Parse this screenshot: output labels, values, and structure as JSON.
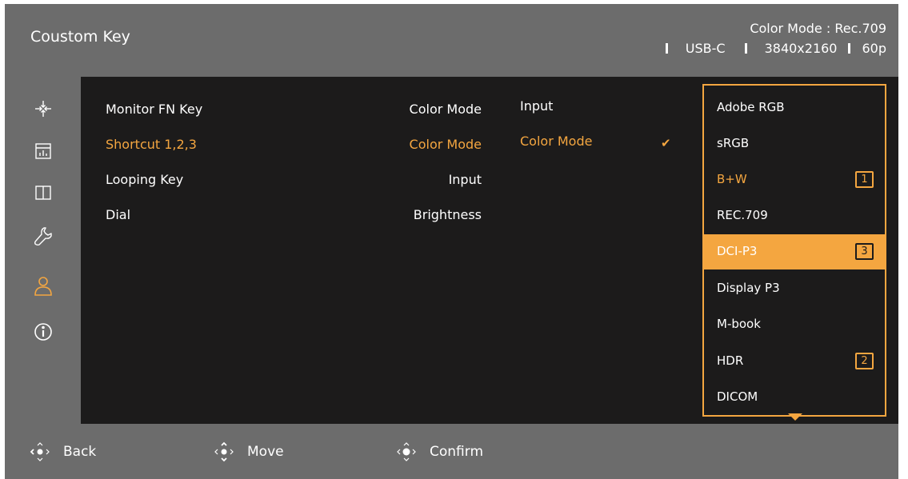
{
  "header": {
    "title": "Coustom Key",
    "color_mode": "Color Mode : Rec.709",
    "input": "USB-C",
    "resolution": "3840x2160",
    "refresh": "60p"
  },
  "sidebar": {
    "icons": [
      "picture-adjust-icon",
      "color-chart-icon",
      "layout-icon",
      "wrench-icon",
      "user-icon",
      "info-icon"
    ],
    "active_index": 4
  },
  "menu": {
    "column1": [
      {
        "label": "Monitor FN Key"
      },
      {
        "label": "Shortcut 1,2,3"
      },
      {
        "label": "Looping Key"
      },
      {
        "label": "Dial"
      }
    ],
    "column2": [
      {
        "label": "Color Mode"
      },
      {
        "label": "Color Mode"
      },
      {
        "label": "Input"
      },
      {
        "label": "Brightness"
      }
    ],
    "column3": [
      {
        "label": "Input"
      },
      {
        "label": "Color Mode"
      }
    ]
  },
  "dropdown": {
    "items": [
      {
        "label": "Adobe RGB",
        "badge": ""
      },
      {
        "label": "sRGB",
        "badge": ""
      },
      {
        "label": "B+W",
        "badge": "1"
      },
      {
        "label": "REC.709",
        "badge": ""
      },
      {
        "label": "DCI-P3",
        "badge": "3"
      },
      {
        "label": "Display P3",
        "badge": ""
      },
      {
        "label": "M-book",
        "badge": ""
      },
      {
        "label": "HDR",
        "badge": "2"
      },
      {
        "label": "DICOM",
        "badge": ""
      }
    ],
    "selected_index": 4,
    "check_mark": "✔"
  },
  "footer": {
    "back_label": "Back",
    "move_label": "Move",
    "confirm_label": "Confirm"
  },
  "colors": {
    "accent": "#f4a640",
    "panel_bg": "#1c1b1b",
    "bar_bg": "#6c6c6c",
    "text": "#ffffff"
  }
}
